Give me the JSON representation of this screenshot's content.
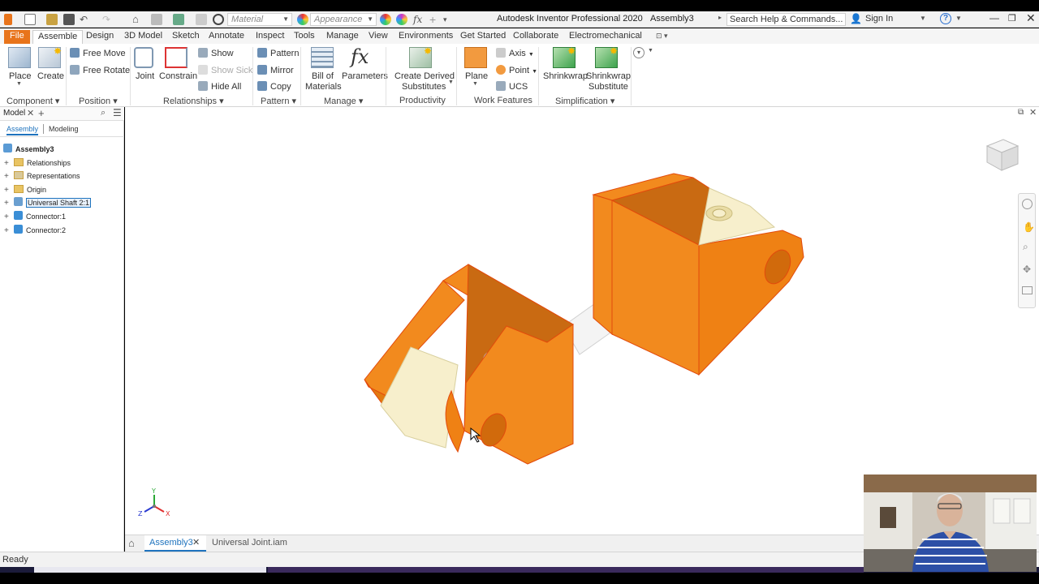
{
  "quick_access": {
    "material_placeholder": "Material",
    "appearance_placeholder": "Appearance"
  },
  "title_bar": {
    "app_name": "Autodesk Inventor Professional 2020",
    "document": "Assembly3",
    "search_placeholder": "Search Help & Commands...",
    "sign_in": "Sign In"
  },
  "tabs": [
    "File",
    "Assemble",
    "Design",
    "3D Model",
    "Sketch",
    "Annotate",
    "Inspect",
    "Tools",
    "Manage",
    "View",
    "Environments",
    "Get Started",
    "Collaborate",
    "Electromechanical"
  ],
  "ribbon": {
    "component": {
      "place": "Place",
      "create": "Create",
      "label": "Component"
    },
    "position": {
      "free_move": "Free Move",
      "free_rotate": "Free Rotate",
      "label": "Position"
    },
    "relationships": {
      "joint": "Joint",
      "constrain": "Constrain",
      "show": "Show",
      "show_sick": "Show Sick",
      "hide_all": "Hide All",
      "label": "Relationships"
    },
    "pattern": {
      "pattern": "Pattern",
      "mirror": "Mirror",
      "copy": "Copy",
      "label": "Pattern"
    },
    "manage": {
      "bom_1": "Bill of",
      "bom_2": "Materials",
      "parameters": "Parameters",
      "label": "Manage"
    },
    "productivity": {
      "derived_1": "Create Derived",
      "derived_2": "Substitutes",
      "label": "Productivity"
    },
    "work_features": {
      "plane": "Plane",
      "axis": "Axis",
      "point": "Point",
      "ucs": "UCS",
      "label": "Work Features"
    },
    "simplification": {
      "shrinkwrap": "Shrinkwrap",
      "shrinkwrap_sub_1": "Shrinkwrap",
      "shrinkwrap_sub_2": "Substitute",
      "label": "Simplification"
    }
  },
  "browser": {
    "title": "Model",
    "tab_assembly": "Assembly",
    "tab_modeling": "Modeling",
    "root": "Assembly3",
    "items": [
      "Relationships",
      "Representations",
      "Origin",
      "Universal Shaft 2:1",
      "Connector:1",
      "Connector:2"
    ]
  },
  "doc_tabs": [
    "Assembly3",
    "Universal Joint.iam"
  ],
  "status": {
    "text": "Ready"
  },
  "triad": {
    "x": "X",
    "y": "Y",
    "z": "Z"
  },
  "colors": {
    "accent": "#e8741b",
    "part_orange": "#f28a1e",
    "part_cream": "#f7efcc",
    "selection_blue": "#1e73be"
  }
}
